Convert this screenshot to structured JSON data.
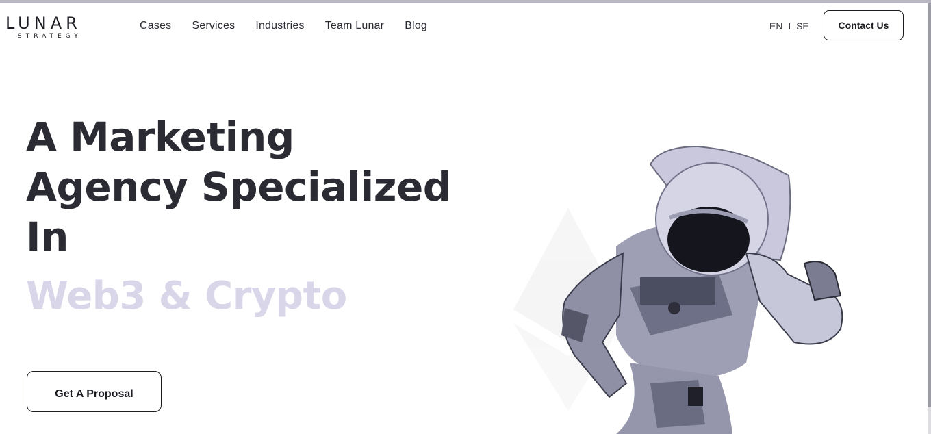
{
  "logo": {
    "main": "LUNAR",
    "sub": "STRATEGY"
  },
  "nav": {
    "items": [
      {
        "label": "Cases"
      },
      {
        "label": "Services"
      },
      {
        "label": "Industries"
      },
      {
        "label": "Team Lunar"
      },
      {
        "label": "Blog"
      }
    ]
  },
  "lang": {
    "en": "EN",
    "separator": "I",
    "se": "SE"
  },
  "header": {
    "contact_label": "Contact Us"
  },
  "hero": {
    "line1": "A Marketing",
    "line2": "Agency Specialized",
    "line3": "In",
    "highlight": "Web3 & Crypto",
    "proposal_label": "Get A Proposal"
  },
  "colors": {
    "text": "#2a2b33",
    "highlight": "#d8d6e8",
    "border": "#1c1d22",
    "background": "#ffffff"
  }
}
